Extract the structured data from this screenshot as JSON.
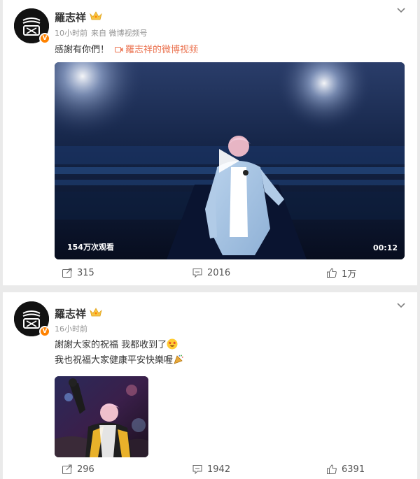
{
  "posts": [
    {
      "author": "羅志祥",
      "time": "10小时前",
      "source": "来自 微博视频号",
      "text": "感謝有你們！",
      "link_text": "羅志祥的微博视频",
      "video": {
        "views": "154万次观看",
        "duration": "00:12"
      },
      "actions": {
        "forward": "315",
        "comment": "2016",
        "like": "1万"
      }
    },
    {
      "author": "羅志祥",
      "time": "16小时前",
      "line1": "謝謝大家的祝福 我都收到了",
      "line2": "我也祝福大家健康平安快樂喔",
      "actions": {
        "forward": "296",
        "comment": "1942",
        "like": "6391"
      }
    }
  ],
  "icons": {
    "verified": "V",
    "crown": "crown-icon",
    "expand": "chevron-down-icon",
    "forward": "forward-icon",
    "comment": "comment-icon",
    "like": "thumbs-up-icon"
  },
  "colors": {
    "link": "#eb7350",
    "verified_badge": "#ff8200",
    "meta": "#939393"
  }
}
